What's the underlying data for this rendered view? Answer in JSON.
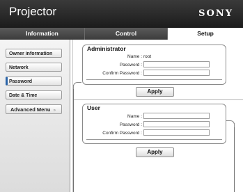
{
  "header": {
    "title": "Projector",
    "brand": "SONY"
  },
  "tabs": [
    {
      "label": "Information"
    },
    {
      "label": "Control"
    },
    {
      "label": "Setup"
    }
  ],
  "sidebar": {
    "items": [
      {
        "label": "Owner information"
      },
      {
        "label": "Network"
      },
      {
        "label": "Password"
      },
      {
        "label": "Date & Time"
      }
    ],
    "advanced": {
      "label": "Advanced Menu",
      "arrow": "»"
    }
  },
  "administrator": {
    "legend": "Administrator",
    "name_label": "Name :",
    "name_value": "root",
    "password_label": "Password :",
    "password_value": "",
    "confirm_label": "Confirm Password :",
    "confirm_value": "",
    "apply_label": "Apply"
  },
  "user": {
    "legend": "User",
    "name_label": "Name :",
    "name_value": "",
    "password_label": "Password :",
    "password_value": "",
    "confirm_label": "Confirm Password :",
    "confirm_value": "",
    "apply_label": "Apply"
  },
  "colors": {
    "header_bg": "#1c1c1c",
    "active_marker": "#2a64a8",
    "border": "#8a8a8a"
  }
}
